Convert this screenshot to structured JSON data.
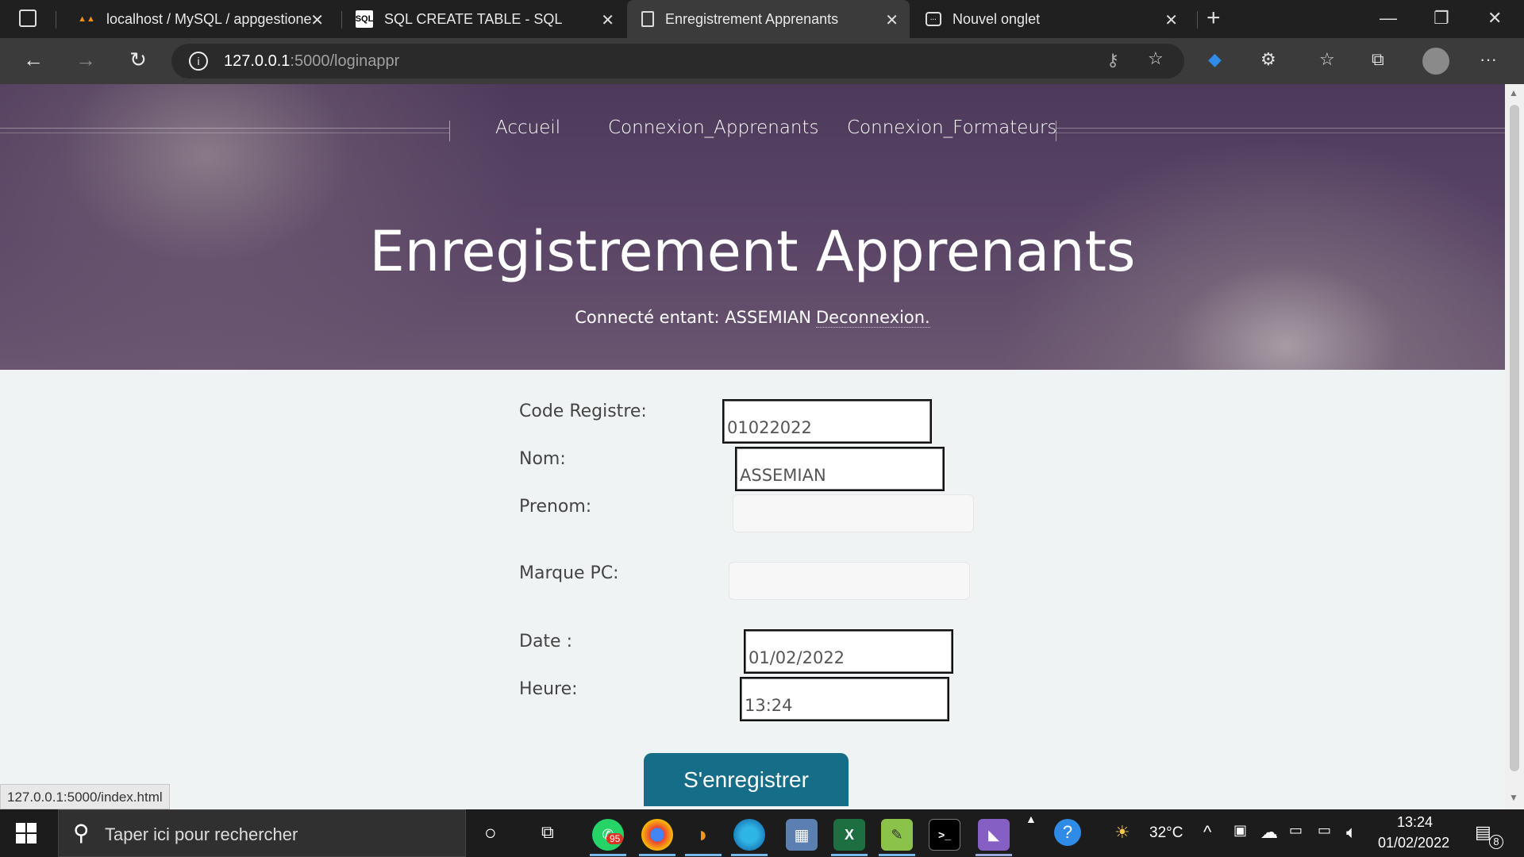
{
  "browser": {
    "tabs": [
      {
        "title": "localhost / MySQL / appgestione",
        "icon": "phpmyadmin-icon"
      },
      {
        "title": "SQL CREATE TABLE - SQL",
        "icon": "sql-icon"
      },
      {
        "title": "Enregistrement Apprenants",
        "icon": "page-icon",
        "active": true
      },
      {
        "title": "Nouvel onglet",
        "icon": "newtab-icon"
      }
    ],
    "address": {
      "host": "127.0.0.1",
      "path": ":5000/loginappr"
    },
    "status_tooltip": "127.0.0.1:5000/index.html"
  },
  "page": {
    "nav": [
      "Accueil",
      "Connexion_Apprenants",
      "Connexion_Formateurs"
    ],
    "title": "Enregistrement Apprenants",
    "subtitle_prefix": "Connecté entant: ASSEMIAN",
    "logout_label": "Deconnexion.",
    "form": {
      "code_label": "Code Registre:",
      "code_value": "01022022",
      "nom_label": "Nom:",
      "nom_value": "ASSEMIAN",
      "prenom_label": "Prenom:",
      "prenom_value": "",
      "marque_label": "Marque PC:",
      "marque_value": "",
      "date_label": "Date :",
      "date_value": "01/02/2022",
      "heure_label": "Heure:",
      "heure_value": "13:24",
      "submit_label": "S'enregistrer"
    },
    "colors": {
      "hero": "#5a4566",
      "button": "#156d87",
      "background": "#f0f3f4"
    }
  },
  "taskbar": {
    "search_placeholder": "Taper ici pour rechercher",
    "whatsapp_badge": "95",
    "weather": "32°C",
    "time": "13:24",
    "date": "01/02/2022",
    "notifications": "8"
  }
}
